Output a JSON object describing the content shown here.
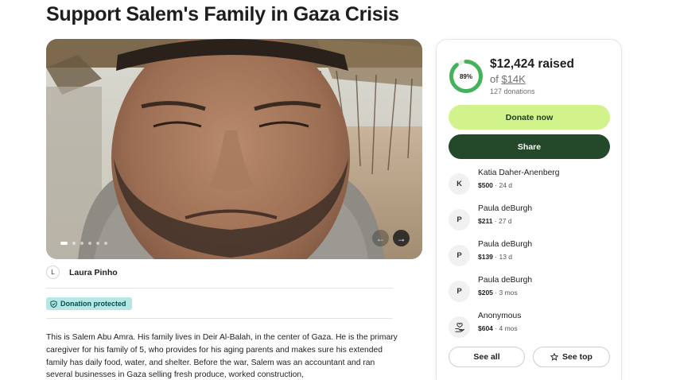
{
  "page": {
    "title": "Support Salem's Family in Gaza Crisis"
  },
  "media": {
    "dots": 6,
    "active_dot": 0,
    "prev_icon": "chevron-left-icon",
    "next_icon": "chevron-right-icon"
  },
  "organizer": {
    "initial": "L",
    "name": "Laura Pinho"
  },
  "badge": {
    "icon": "shield-icon",
    "label": "Donation protected"
  },
  "story": {
    "text": "This is Salem Abu Amra. His family lives in Deir Al-Balah, in the center of Gaza. He is the primary caregiver for his family of 5, who provides for his aging parents and makes sure his extended family has daily food, water, and shelter. Before the war, Salem was an accountant and ran several businesses in Gaza selling fresh produce, worked construction,"
  },
  "fundraiser": {
    "progress_percent": 89,
    "progress_label": "89%",
    "raised": "$12,424 raised",
    "goal_prefix": "of ",
    "goal": "$14K",
    "donations": "127 donations",
    "donate_label": "Donate now",
    "share_label": "Share",
    "colors": {
      "progress": "#43b25b",
      "donate_bg": "#d2f38b",
      "share_bg": "#23482a",
      "badge_bg": "#b5e7e4"
    }
  },
  "donors": [
    {
      "initial": "K",
      "name": "Katia Daher-Anenberg",
      "amount": "$500",
      "time": " · 24 d"
    },
    {
      "initial": "P",
      "name": "Paula deBurgh",
      "amount": "$211",
      "time": " · 27 d"
    },
    {
      "initial": "P",
      "name": "Paula deBurgh",
      "amount": "$139",
      "time": " · 13 d"
    },
    {
      "initial": "P",
      "name": "Paula deBurgh",
      "amount": "$205",
      "time": " · 3 mos"
    },
    {
      "initial": "",
      "icon": "hand-heart-icon",
      "name": "Anonymous",
      "amount": "$604",
      "time": " · 4 mos"
    }
  ],
  "actions": {
    "see_all": "See all",
    "see_top": "See top",
    "see_top_icon": "star-icon"
  }
}
